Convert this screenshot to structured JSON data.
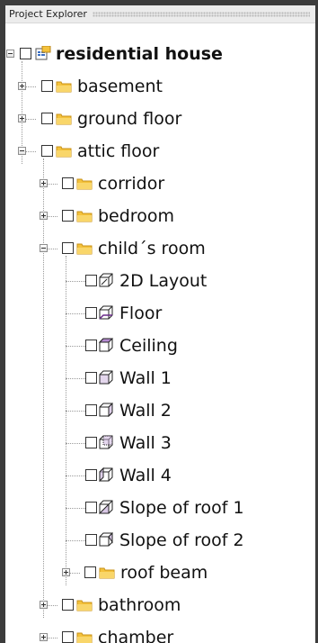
{
  "panel": {
    "title": "Project Explorer"
  },
  "tree": {
    "root": {
      "label": "residential house",
      "icon": "project-icon"
    },
    "basement": {
      "label": "basement",
      "icon": "folder-icon"
    },
    "ground_floor": {
      "label": "ground floor",
      "icon": "folder-icon"
    },
    "attic_floor": {
      "label": "attic floor",
      "icon": "folder-icon"
    },
    "corridor": {
      "label": "corridor",
      "icon": "folder-icon"
    },
    "bedroom": {
      "label": "bedroom",
      "icon": "folder-icon"
    },
    "childs_room": {
      "label": "child´s room",
      "icon": "folder-icon"
    },
    "layout_2d": {
      "label": "2D Layout",
      "icon": "cube-icon"
    },
    "floor": {
      "label": "Floor",
      "icon": "cube-icon"
    },
    "ceiling": {
      "label": "Ceiling",
      "icon": "cube-icon"
    },
    "wall1": {
      "label": "Wall 1",
      "icon": "cube-icon"
    },
    "wall2": {
      "label": "Wall 2",
      "icon": "cube-icon"
    },
    "wall3": {
      "label": "Wall 3",
      "icon": "cube-icon"
    },
    "wall4": {
      "label": "Wall 4",
      "icon": "cube-icon"
    },
    "slope1": {
      "label": "Slope of roof 1",
      "icon": "cube-icon"
    },
    "slope2": {
      "label": "Slope of roof 2",
      "icon": "cube-icon"
    },
    "roof_beam": {
      "label": "roof beam",
      "icon": "folder-icon"
    },
    "bathroom": {
      "label": "bathroom",
      "icon": "folder-icon"
    },
    "chamber": {
      "label": "chamber",
      "icon": "folder-icon"
    }
  },
  "colors": {
    "folder": "#f4c23c",
    "folder_dark": "#c99218",
    "background": "#3c3c3c"
  }
}
